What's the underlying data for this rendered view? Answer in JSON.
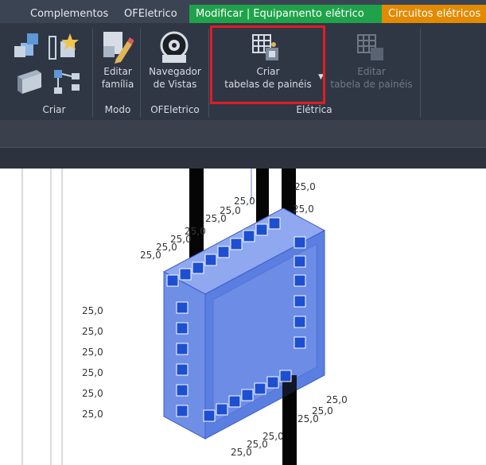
{
  "tabs": [
    "Complementos",
    "OFEletrico",
    "Modificar | Equipamento elétrico",
    "Circuitos elétricos"
  ],
  "ribbon": {
    "editar_familia": [
      "Editar",
      "família"
    ],
    "navegador": [
      "Navegador",
      "de Vistas"
    ],
    "criar_tabelas": [
      "Criar",
      "tabelas de painéis"
    ],
    "editar_tabela": [
      "Editar",
      "tabela de painéis"
    ],
    "groups": [
      "Criar",
      "Modo",
      "OFEletrico",
      "Elétrica"
    ]
  },
  "dims": {
    "value": "25,0"
  },
  "icons": [
    "family-icon",
    "edit-family-icon",
    "view-navigator-icon",
    "panel-schedule-icon",
    "panel-schedule-edit-icon"
  ],
  "colors": {
    "highlight": "#e01c24",
    "active_tab": "#1fa34a",
    "orange_tab": "#e38a00",
    "panel": "#5b7fe0"
  }
}
